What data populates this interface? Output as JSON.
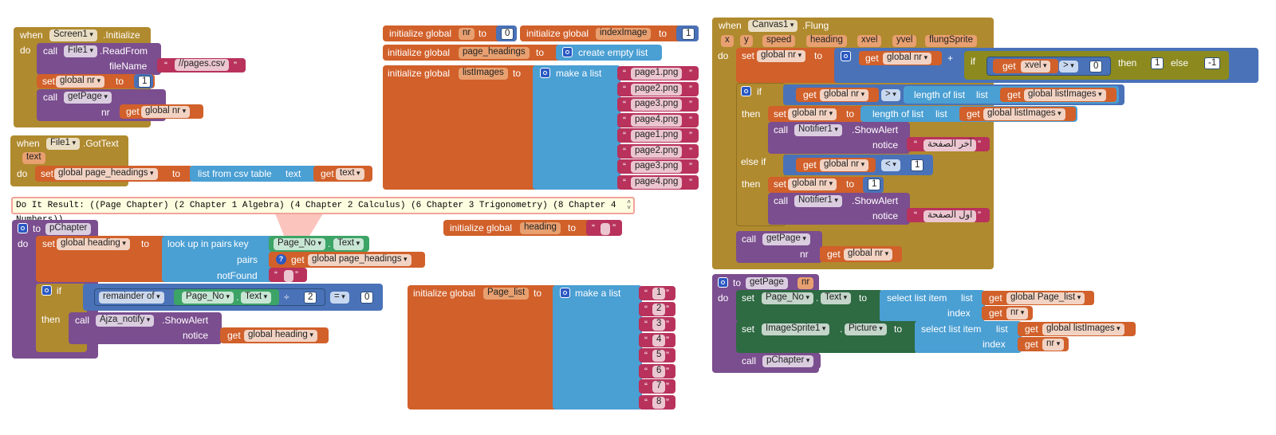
{
  "colors": {
    "control": "#b08a2e",
    "procedure": "#7b4e8f",
    "variable": "#d1602a",
    "list": "#4a9fd3",
    "math": "#4a72b8",
    "text": "#b8325c",
    "component": "#2e6a42",
    "compare": "#3ca466",
    "error_bubble": "#f2a39b"
  },
  "icons": {
    "mutator": "gear-icon",
    "warning": "question-icon"
  },
  "kw": {
    "when": "when",
    "do": "do",
    "call": "call",
    "set": "set",
    "to": "to",
    "get": "get",
    "initialize_global": "initialize global",
    "if": "if",
    "then": "then",
    "else": "else",
    "else_if": "else if",
    "make_a_list": "make a list",
    "create_empty_list": "create empty list",
    "list": "list",
    "index": "index",
    "notice": "notice",
    "nr": "nr",
    "text": "text",
    "key": "key",
    "pairs": "pairs",
    "notFound": "notFound",
    "length_of_list": "length of list",
    "select_list_item": "select list item",
    "list_from_csv_table": "list from csv table",
    "look_up_in_pairs": "look up in pairs",
    "remainder_of": "remainder of",
    "quote": "“",
    "quote_end": "”",
    "dot": "."
  },
  "screen_init": {
    "component": "Screen1",
    "event": ".Initialize",
    "file": "File1",
    "method": ".ReadFrom",
    "param": "fileName",
    "filename": "//pages.csv",
    "var": "global nr",
    "value": "1",
    "proc": "getPage",
    "arg": "nr"
  },
  "gottext": {
    "component": "File1",
    "event": ".GotText",
    "param": "text",
    "var": "global page_headings",
    "get": "text"
  },
  "globals": {
    "nr": {
      "name": "nr",
      "value": "0"
    },
    "indexImage": {
      "name": "indexImage",
      "value": "1"
    },
    "page_headings": {
      "name": "page_headings"
    },
    "listImages": {
      "name": "listImages",
      "items": [
        "page1.png",
        "page2.png",
        "page3.png",
        "page4.png",
        "page1.png",
        "page2.png",
        "page3.png",
        "page4.png"
      ]
    },
    "heading": {
      "name": "heading",
      "value": ""
    },
    "Page_list": {
      "name": "Page_list",
      "items": [
        "1",
        "2",
        "3",
        "4",
        "5",
        "6",
        "7",
        "8"
      ]
    }
  },
  "doit": {
    "text": "Do It Result: ((Page Chapter) (2 Chapter 1 Algebra) (4 Chapter 2 Calculus) (6 Chapter 3 Trigonometry) (8 Chapter 4 Numbers))",
    "scroll_up": "˄",
    "scroll_down": "˅"
  },
  "pchapter": {
    "proc": "pChapter",
    "var": "global heading",
    "key_comp": "Page_No",
    "key_prop": "Text",
    "pairs_var": "global page_headings",
    "op": "=",
    "divisor": "2",
    "compare_val": "0",
    "notify_comp": "Ajza_notify",
    "notify_method": ".ShowAlert",
    "notice_var": "global heading"
  },
  "fling": {
    "component": "Canvas1",
    "event": ".Flung",
    "params": [
      "x",
      "y",
      "speed",
      "heading",
      "xvel",
      "yvel",
      "flungSprite"
    ],
    "set_var": "global nr",
    "add_var": "global nr",
    "plus": "+",
    "cond_var": "xvel",
    "gt": ">",
    "zero": "0",
    "one": "1",
    "neg_one": "-1",
    "if2_var": "global nr",
    "if2_op": ">",
    "if2_list": "global listImages",
    "then_set": "global nr",
    "then_list": "global listImages",
    "notifier": "Notifier1",
    "show_alert": ".ShowAlert",
    "alert1": "آخر الصفحة",
    "elseif_var": "global nr",
    "lt": "<",
    "elseif_val": "1",
    "then2_set": "global nr",
    "then2_val": "1",
    "alert2": "اول الصفحة",
    "call_proc": "getPage",
    "call_arg": "global nr"
  },
  "getpage": {
    "proc": "getPage",
    "param": "nr",
    "comp1": "Page_No",
    "prop1": "Text",
    "list1": "global Page_list",
    "idx": "nr",
    "comp2": "ImageSprite1",
    "prop2": "Picture",
    "list2": "global listImages",
    "call_proc": "pChapter"
  }
}
